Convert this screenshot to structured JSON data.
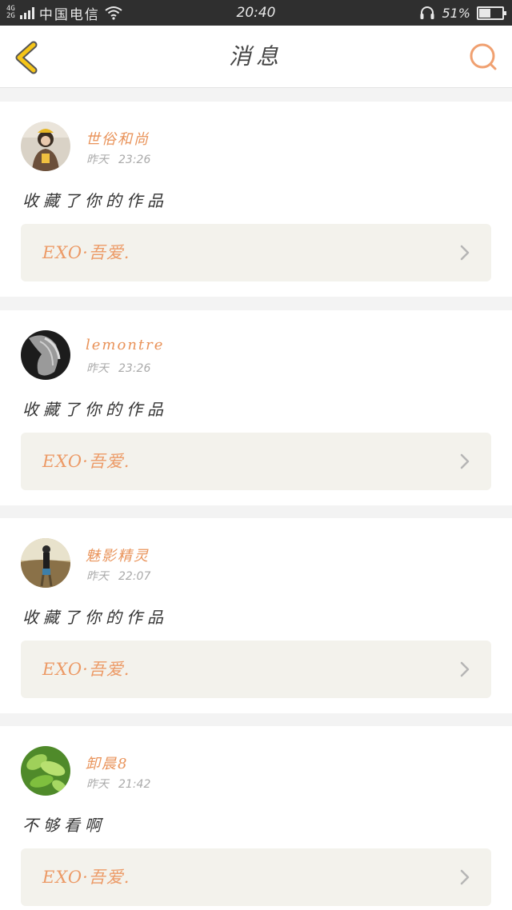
{
  "status_bar": {
    "net_top": "4G",
    "net_bottom": "2G",
    "carrier": "中国电信",
    "time": "20:40",
    "battery_percent": "51%",
    "battery_level": 0.51,
    "icons": [
      "signal-icon",
      "wifi-icon",
      "headset-icon",
      "battery-icon"
    ]
  },
  "nav": {
    "title": "消息",
    "back_icon": "chevron-left-icon",
    "search_icon": "search-icon",
    "accent_color": "#f5c518",
    "search_color": "#f0a070"
  },
  "messages": [
    {
      "username": "世俗和尚",
      "day": "昨天",
      "time": "23:26",
      "text": "收藏了你的作品",
      "work_title": "EXO·吾爱."
    },
    {
      "username": "lemontre",
      "day": "昨天",
      "time": "23:26",
      "text": "收藏了你的作品",
      "work_title": "EXO·吾爱."
    },
    {
      "username": "魅影精灵",
      "day": "昨天",
      "time": "22:07",
      "text": "收藏了你的作品",
      "work_title": "EXO·吾爱."
    },
    {
      "username": "卸晨8",
      "day": "昨天",
      "time": "21:42",
      "text": "不够看啊",
      "work_title": "EXO·吾爱."
    }
  ]
}
